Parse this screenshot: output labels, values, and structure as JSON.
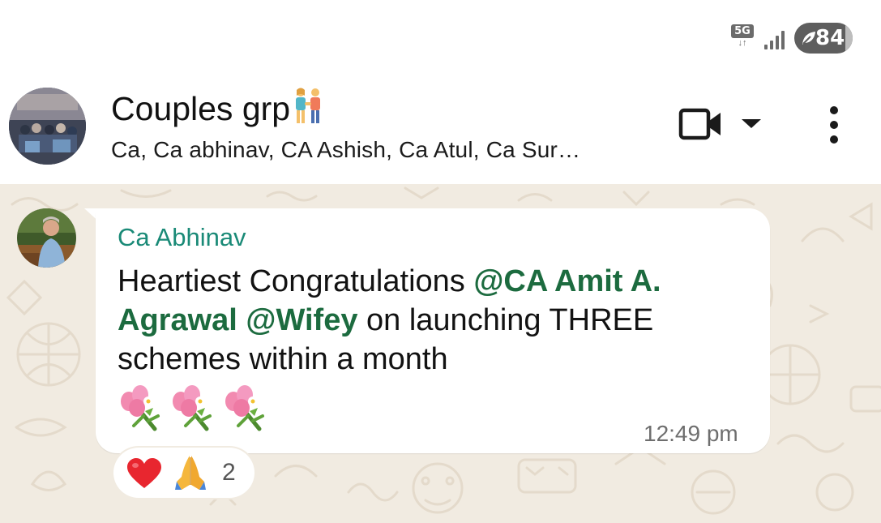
{
  "status_bar": {
    "network": "5G",
    "network_arrows": "↓↑",
    "battery_level": "84"
  },
  "header": {
    "title": "Couples grp",
    "title_emoji": "couple-holding-hands",
    "members": "Ca, Ca abhinav, CA Ashish, Ca Atul, Ca Sur…",
    "icons": [
      "video-call-icon",
      "chevron-down-icon",
      "more-options-icon"
    ]
  },
  "message": {
    "sender": "Ca Abhinav",
    "text_before": "Heartiest Congratulations ",
    "mention_1": "@CA Amit A. Agrawal",
    "text_between": " ",
    "mention_2": "@Wifey",
    "text_after": " on launching THREE schemes within a month",
    "emoji": [
      "bouquet",
      "bouquet",
      "bouquet"
    ],
    "time": "12:49 pm"
  },
  "reactions": {
    "items": [
      "red-heart",
      "folded-hands"
    ],
    "count": "2"
  },
  "colors": {
    "sender_name": "#1a8a77",
    "mention": "#1c6b3f",
    "chat_background": "#f1ebe1"
  }
}
